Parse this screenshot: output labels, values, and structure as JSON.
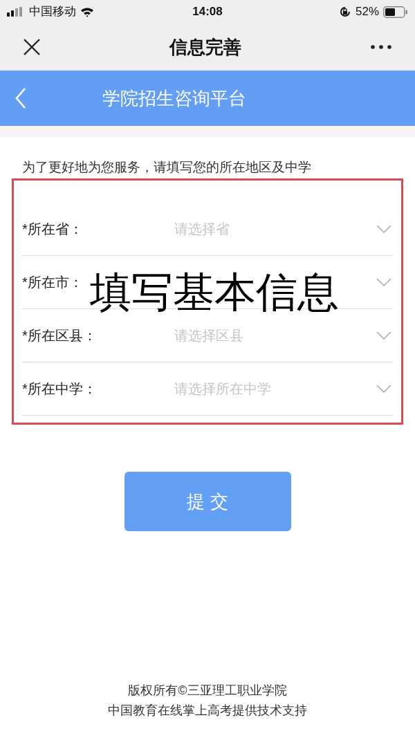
{
  "status_bar": {
    "carrier": "中国移动",
    "time": "14:08",
    "battery": "52%"
  },
  "nav_bar": {
    "title": "信息完善"
  },
  "banner": {
    "title": "学院招生咨询平台"
  },
  "intro": "为了更好地为您服务，请填写您的所在地区及中学",
  "fields": [
    {
      "label": "*所在省：",
      "placeholder": "请选择省"
    },
    {
      "label": "*所在市："
    },
    {
      "label": "*所在区县：",
      "placeholder": "请选择区县"
    },
    {
      "label": "*所在中学：",
      "placeholder": "请选择所在中学"
    }
  ],
  "submit": "提 交",
  "annotation": "填写基本信息",
  "footer": [
    "版权所有©三亚理工职业学院",
    "中国教育在线掌上高考提供技术支持"
  ]
}
